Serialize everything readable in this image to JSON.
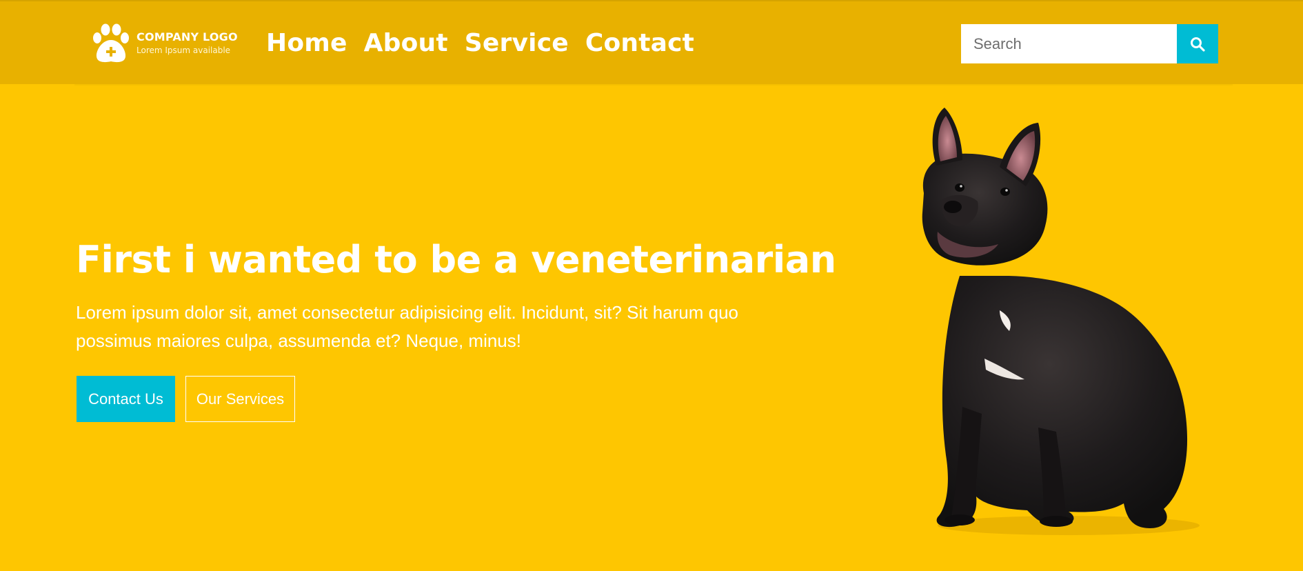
{
  "header": {
    "logo": {
      "icon": "paw-plus-icon",
      "title": "COMPANY LOGO",
      "subtitle": "Lorem Ipsum available"
    },
    "nav": [
      {
        "label": "Home"
      },
      {
        "label": "About"
      },
      {
        "label": "Service"
      },
      {
        "label": "Contact"
      }
    ],
    "search": {
      "placeholder": "Search",
      "icon": "search-icon"
    }
  },
  "hero": {
    "title": "First i wanted to be a veneterinarian",
    "text": "Lorem ipsum dolor sit, amet consectetur adipisicing elit. Incidunt, sit? Sit harum quo possimus maiores culpa, assumenda et? Neque, minus!",
    "buttons": {
      "primary": "Contact Us",
      "secondary": "Our Services"
    },
    "image": "french-bulldog-image"
  },
  "colors": {
    "background": "#FEC601",
    "header": "#E8B100",
    "accent": "#00BCD4",
    "text": "#FFFFFF"
  }
}
